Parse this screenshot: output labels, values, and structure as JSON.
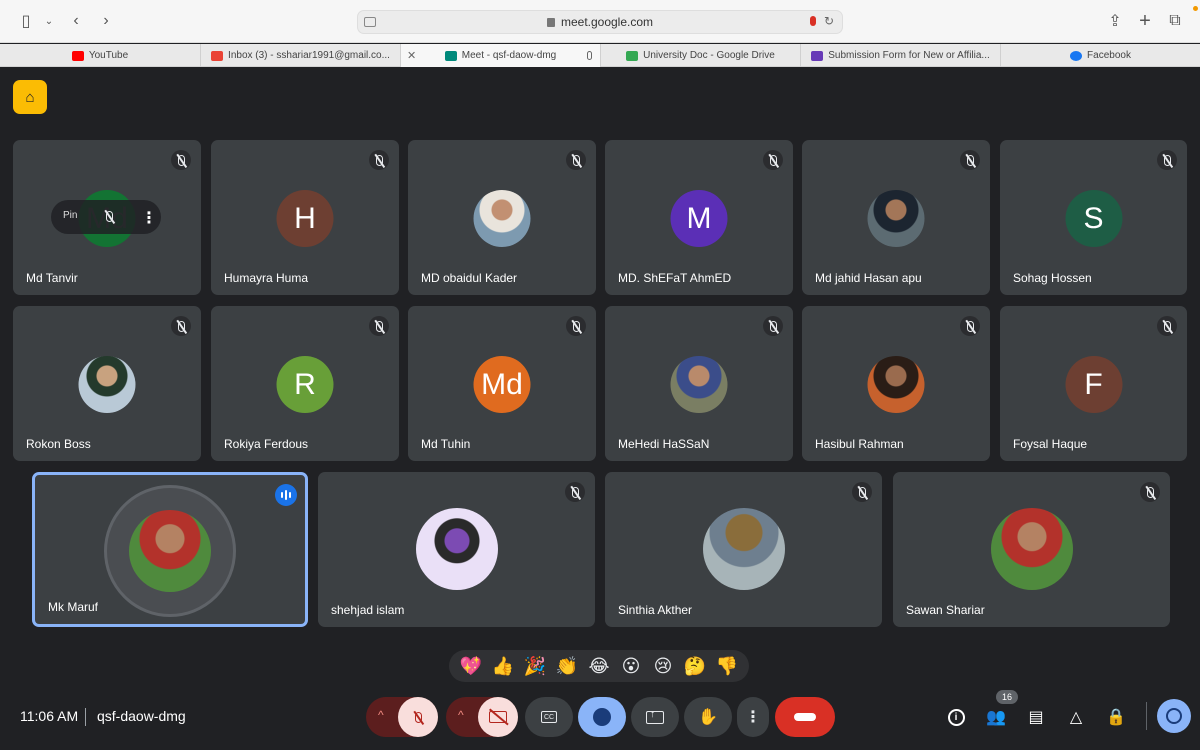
{
  "browser": {
    "url": "meet.google.com",
    "tabs": [
      {
        "label": "YouTube",
        "color": "#ff0000"
      },
      {
        "label": "Inbox (3) - sshariar1991@gmail.co...",
        "color": "#ea4335"
      },
      {
        "label": "Meet - qsf-daow-dmg",
        "color": "#00897b",
        "active": true
      },
      {
        "label": "University Doc - Google Drive",
        "color": "#34a853"
      },
      {
        "label": "Submission Form for New or Affilia...",
        "color": "#673ab7"
      },
      {
        "label": "Facebook",
        "color": "#1877f2"
      }
    ]
  },
  "meet": {
    "brand_icon": "door-icon",
    "pin_label": "Pin",
    "tiles_row1": [
      {
        "name": "Md Tanvir",
        "initials": "Md",
        "avatar_color": "#137333"
      },
      {
        "name": "Humayra Huma",
        "initials": "H",
        "avatar_color": "#6d3f32"
      },
      {
        "name": "MD obaidul Kader",
        "initials": "",
        "avatar_type": "photo"
      },
      {
        "name": "MD. ShEFaT AhmED",
        "initials": "M",
        "avatar_color": "#5b2fb6"
      },
      {
        "name": "Md jahid Hasan apu",
        "initials": "",
        "avatar_type": "photo"
      },
      {
        "name": "Sohag Hossen",
        "initials": "S",
        "avatar_color": "#1e5d45"
      }
    ],
    "tiles_row2": [
      {
        "name": "Rokon Boss",
        "initials": "",
        "avatar_type": "photo"
      },
      {
        "name": "Rokiya Ferdous",
        "initials": "R",
        "avatar_color": "#689f38"
      },
      {
        "name": "Md Tuhin",
        "initials": "Md",
        "avatar_color": "#e06b1f"
      },
      {
        "name": "MeHedi HaSSaN",
        "initials": "",
        "avatar_type": "photo"
      },
      {
        "name": "Hasibul Rahman",
        "initials": "",
        "avatar_type": "photo"
      },
      {
        "name": "Foysal Haque",
        "initials": "F",
        "avatar_color": "#6d3f32"
      }
    ],
    "tiles_row3": [
      {
        "name": "Mk Maruf",
        "speaking": true
      },
      {
        "name": "shehjad islam"
      },
      {
        "name": "Sinthia Akther"
      },
      {
        "name": "Sawan Shariar"
      }
    ],
    "reactions": [
      "💖",
      "👍",
      "🎉",
      "👏",
      "😂",
      "😮",
      "😢",
      "🤔",
      "👎"
    ],
    "clock": "11:06 AM",
    "meeting_code": "qsf-daow-dmg",
    "participant_count": "16",
    "accent": "#8ab4f8",
    "hangup_color": "#d93025"
  }
}
